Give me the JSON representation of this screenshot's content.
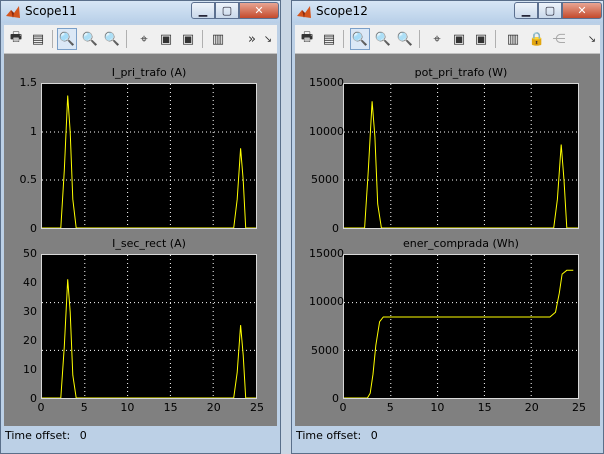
{
  "windows": [
    {
      "title": "Scope11",
      "toolbar_overflow": "»",
      "status": {
        "label": "Time offset:",
        "value": "0"
      },
      "axes": [
        {
          "title": "I_pri_trafo (A)",
          "yticks": [
            "0",
            "0.5",
            "1",
            "1.5"
          ],
          "xticks": [
            "0",
            "5",
            "10",
            "15",
            "20",
            "25"
          ]
        },
        {
          "title": "I_sec_rect (A)",
          "yticks": [
            "0",
            "10",
            "20",
            "30",
            "40",
            "50"
          ],
          "xticks": [
            "0",
            "5",
            "10",
            "15",
            "20",
            "25"
          ]
        }
      ]
    },
    {
      "title": "Scope12",
      "status": {
        "label": "Time offset:",
        "value": "0"
      },
      "axes": [
        {
          "title": "pot_pri_trafo (W)",
          "yticks": [
            "0",
            "5000",
            "10000",
            "15000"
          ],
          "xticks": [
            "0",
            "5",
            "10",
            "15",
            "20",
            "25"
          ]
        },
        {
          "title": "ener_comprada (Wh)",
          "yticks": [
            "0",
            "5000",
            "10000",
            "15000"
          ],
          "xticks": [
            "0",
            "5",
            "10",
            "15",
            "20",
            "25"
          ]
        }
      ]
    }
  ],
  "colors": {
    "trace": "#ffff00",
    "axes_bg": "#000000",
    "figure_bg": "#808080",
    "grid": "#ffffff"
  },
  "chart_data": [
    {
      "type": "line",
      "title": "I_pri_trafo (A)",
      "xlim": [
        0,
        25
      ],
      "ylim": [
        0,
        1.5
      ],
      "grid": true,
      "series": [
        {
          "x": [
            0,
            2.2,
            2.6,
            3.0,
            3.3,
            3.6,
            4.0,
            22.4,
            22.8,
            23.2,
            23.5,
            23.8,
            25
          ],
          "y": [
            0,
            0,
            0.6,
            1.38,
            1.0,
            0.3,
            0,
            0,
            0.3,
            0.83,
            0.5,
            0,
            0
          ]
        }
      ]
    },
    {
      "type": "line",
      "title": "I_sec_rect (A)",
      "xlim": [
        0,
        25
      ],
      "ylim": [
        0,
        50
      ],
      "grid": true,
      "series": [
        {
          "x": [
            0,
            2.2,
            2.6,
            3.0,
            3.3,
            3.6,
            4.0,
            22.4,
            22.8,
            23.2,
            23.5,
            23.8,
            25
          ],
          "y": [
            0,
            0,
            18,
            41.5,
            30,
            8,
            0,
            0,
            9,
            25.5,
            15,
            0,
            0
          ]
        }
      ]
    },
    {
      "type": "line",
      "title": "pot_pri_trafo (W)",
      "xlim": [
        0,
        25
      ],
      "ylim": [
        0,
        15000
      ],
      "grid": true,
      "series": [
        {
          "x": [
            0,
            2.2,
            2.6,
            3.0,
            3.3,
            3.6,
            4.0,
            22.4,
            22.8,
            23.2,
            23.5,
            23.8,
            25
          ],
          "y": [
            0,
            0,
            6000,
            13200,
            9500,
            2500,
            0,
            0,
            3000,
            8700,
            5000,
            0,
            0
          ]
        }
      ]
    },
    {
      "type": "line",
      "title": "ener_comprada (Wh)",
      "xlim": [
        0,
        25
      ],
      "ylim": [
        0,
        15000
      ],
      "grid": true,
      "series": [
        {
          "x": [
            0,
            2.5,
            2.8,
            3.1,
            3.4,
            3.8,
            4.2,
            22.0,
            22.6,
            23.0,
            23.3,
            23.8,
            24.5
          ],
          "y": [
            0,
            0,
            500,
            2500,
            5500,
            8000,
            8500,
            8500,
            9000,
            11000,
            13000,
            13400,
            13400
          ]
        }
      ]
    }
  ]
}
